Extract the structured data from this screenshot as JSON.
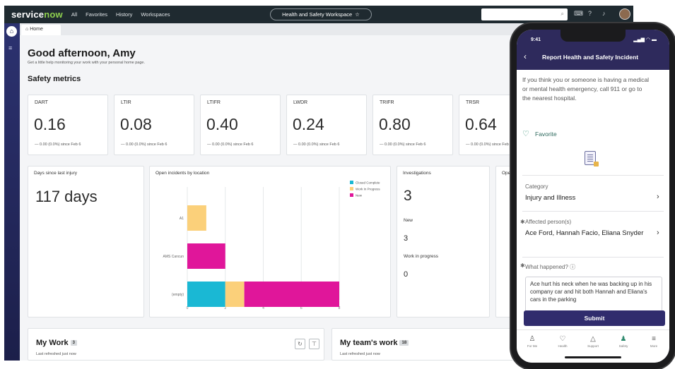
{
  "topbar": {
    "logo_service": "service",
    "logo_now": "now",
    "nav": [
      "All",
      "Favorites",
      "History",
      "Workspaces"
    ],
    "workspace": "Health and Safety Workspace",
    "star": "☆"
  },
  "tabs": {
    "home": "Home"
  },
  "content": {
    "greeting": "Good afternoon, Amy",
    "subtitle": "Get a little help monitoring your work with your personal home page.",
    "metrics_title": "Safety metrics",
    "metrics": [
      {
        "label": "DART",
        "value": "0.16",
        "delta": "— 0.00 (0.0%) since Feb 6"
      },
      {
        "label": "LTIR",
        "value": "0.08",
        "delta": "— 0.00 (0.0%) since Feb 6"
      },
      {
        "label": "LTIFR",
        "value": "0.40",
        "delta": "— 0.00 (0.0%) since Feb 6"
      },
      {
        "label": "LWDR",
        "value": "0.24",
        "delta": "— 0.00 (0.0%) since Feb 6"
      },
      {
        "label": "TRIFR",
        "value": "0.80",
        "delta": "— 0.00 (0.0%) since Feb 6"
      },
      {
        "label": "TRSR",
        "value": "0.64",
        "delta": "— 0.00 (0.0%) since Feb 6"
      }
    ],
    "days_panel": {
      "title": "Days since last injury",
      "value": "117 days"
    },
    "investigations": {
      "title": "Investigations",
      "total": "3",
      "new_label": "New",
      "new_value": "3",
      "wip_label": "Work in progress",
      "wip_value": "0"
    },
    "extra_panel_title": "Ope",
    "my_work": {
      "title": "My Work",
      "count": "3",
      "sub": "Last refreshed just now"
    },
    "team_work": {
      "title": "My team's work",
      "count": "18",
      "sub": "Last refreshed just now"
    }
  },
  "chart_data": {
    "type": "bar",
    "orientation": "horizontal",
    "stacked": true,
    "title": "Open incidents by location",
    "categories": [
      "A1",
      "AMS Cancun",
      "(empty)"
    ],
    "series": [
      {
        "name": "Closed Complete",
        "color": "#1ab8d4",
        "values": [
          0,
          0,
          2
        ]
      },
      {
        "name": "Work In Progress",
        "color": "#fbd07a",
        "values": [
          1,
          0,
          1
        ]
      },
      {
        "name": "New",
        "color": "#e0169a",
        "values": [
          0,
          2,
          5
        ]
      }
    ],
    "x_ticks": [
      "0",
      "2",
      "4",
      "6",
      "8"
    ],
    "xlim": [
      0,
      8
    ],
    "grid": true,
    "legend": "top-right"
  },
  "phone": {
    "time": "9:41",
    "status_icons": "▂▄▆ ◠ ▬",
    "title": "Report Health and Safety Incident",
    "emergency_text": "If you think you or someone is having a medical or mental health emergency, call 911 or go to the nearest hospital.",
    "favorite": "Favorite",
    "category_label": "Category",
    "category_value": "Injury and Illness",
    "affected_label": "Affected person(s)",
    "affected_value": "Ace Ford, Hannah Facio, Eliana Snyder",
    "what_label": "What happened?",
    "what_value": "Ace hurt his neck when he was backing up in his company car and hit both Hannah and Eliana's cars in the parking",
    "submit": "Submit",
    "tabbar": [
      {
        "icon": "person-icon",
        "glyph": "♙",
        "label": "For Me"
      },
      {
        "icon": "heart-icon",
        "glyph": "♡",
        "label": "Health"
      },
      {
        "icon": "warning-icon",
        "glyph": "△",
        "label": "Support"
      },
      {
        "icon": "safety-icon",
        "glyph": "♟",
        "label": "Safety"
      },
      {
        "icon": "menu-icon",
        "glyph": "≡",
        "label": "More"
      }
    ]
  }
}
